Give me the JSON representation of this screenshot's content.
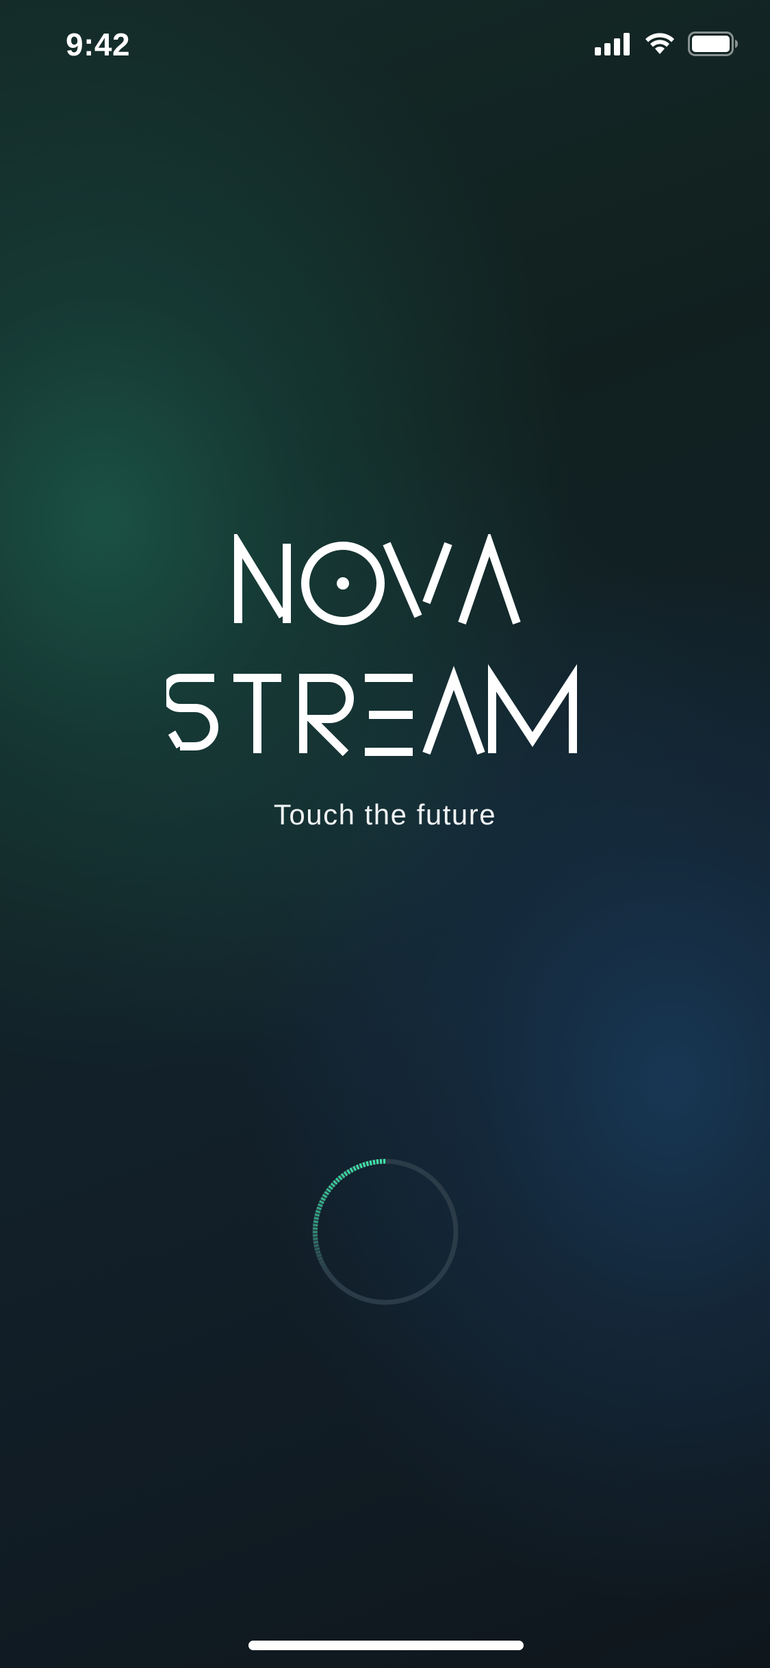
{
  "status_bar": {
    "time": "9:42",
    "icons": [
      "cellular-signal-icon",
      "wifi-icon",
      "battery-icon"
    ]
  },
  "logo": {
    "line1": "NOVA",
    "line2": "STREAM"
  },
  "tagline": "Touch the future",
  "loading": {
    "icons": [
      "loading-spinner-icon"
    ],
    "accent_color": "#3ee6a8",
    "track_color": "#2b3b48"
  },
  "colors": {
    "background_green": "#1b5446",
    "background_blue": "#183856",
    "text": "#ffffff"
  }
}
